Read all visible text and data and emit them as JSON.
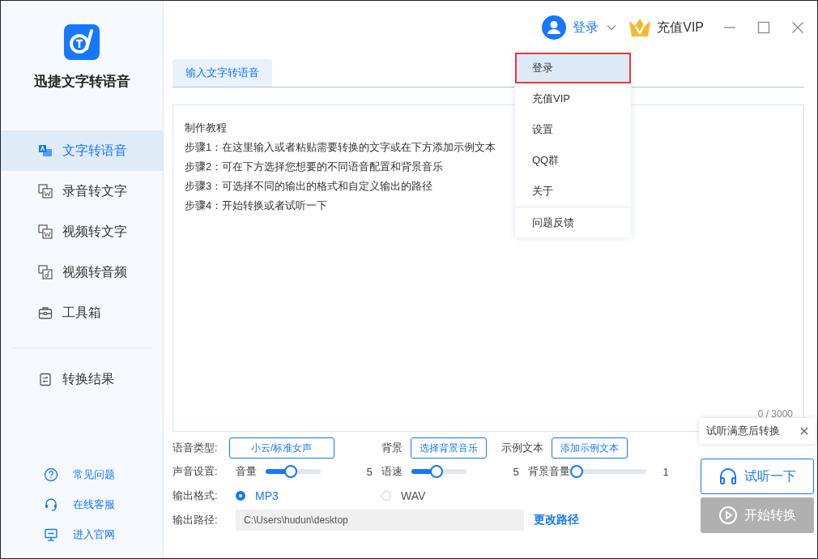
{
  "app": {
    "name": "迅捷文字转语音"
  },
  "sidebar": {
    "nav": [
      {
        "label": "文字转语音",
        "kind": "tts",
        "selected": true
      },
      {
        "label": "录音转文字",
        "kind": "rec",
        "selected": false
      },
      {
        "label": "视频转文字",
        "kind": "video-text",
        "selected": false
      },
      {
        "label": "视频转音频",
        "kind": "video-audio",
        "selected": false
      },
      {
        "label": "工具箱",
        "kind": "tools",
        "selected": false
      }
    ],
    "results": {
      "label": "转换结果"
    },
    "links": [
      {
        "label": "常见问题",
        "kind": "help"
      },
      {
        "label": "在线客服",
        "kind": "service"
      },
      {
        "label": "进入官网",
        "kind": "site"
      }
    ]
  },
  "topbar": {
    "user": "登录",
    "vip": "充值VIP"
  },
  "tabs": [
    {
      "label": "输入文字转语音",
      "selected": true
    }
  ],
  "editor": {
    "lines": [
      "制作教程",
      "步骤1：在这里输入或者粘贴需要转换的文字或在下方添加示例文本",
      "步骤2：可在下方选择您想要的不同语音配置和背景音乐",
      "步骤3：可选择不同的输出的格式和自定义输出的路径",
      "步骤4：开始转换或者试听一下"
    ],
    "counter": "0 / 3000"
  },
  "settings": {
    "pickers": [
      {
        "label": "语音类型:",
        "button": "小云/标准女声"
      },
      {
        "label": "背景",
        "button": "选择背景音乐"
      },
      {
        "label": "示例文本",
        "button": "添加示例文本"
      }
    ],
    "sound_label": "声音设置:",
    "sliders": [
      {
        "label": "音量",
        "level": 0.45,
        "reading": "5"
      },
      {
        "label": "语速",
        "level": 0.45,
        "reading": "5"
      },
      {
        "label": "背景音量",
        "level": 0.0,
        "reading": "1"
      }
    ],
    "format_label": "输出格式:",
    "formats": [
      {
        "label": "MP3",
        "selected": true
      },
      {
        "label": "WAV",
        "selected": false
      }
    ],
    "path_label": "输出路径:",
    "path": "C:\\Users\\hudun\\desktop",
    "change_path": "更改路径"
  },
  "tooltip": "试听满意后转换",
  "listen": {
    "label": "试听一下",
    "disabled": false
  },
  "start": {
    "label": "开始转换",
    "disabled": true
  },
  "menu": [
    {
      "label": "登录",
      "selected": true,
      "separated": false
    },
    {
      "label": "充值VIP",
      "selected": false,
      "separated": false
    },
    {
      "label": "设置",
      "selected": false,
      "separated": false
    },
    {
      "label": "QQ群",
      "selected": false,
      "separated": false
    },
    {
      "label": "关于",
      "selected": false,
      "separated": false
    },
    {
      "label": "问题反馈",
      "selected": false,
      "separated": true
    }
  ]
}
